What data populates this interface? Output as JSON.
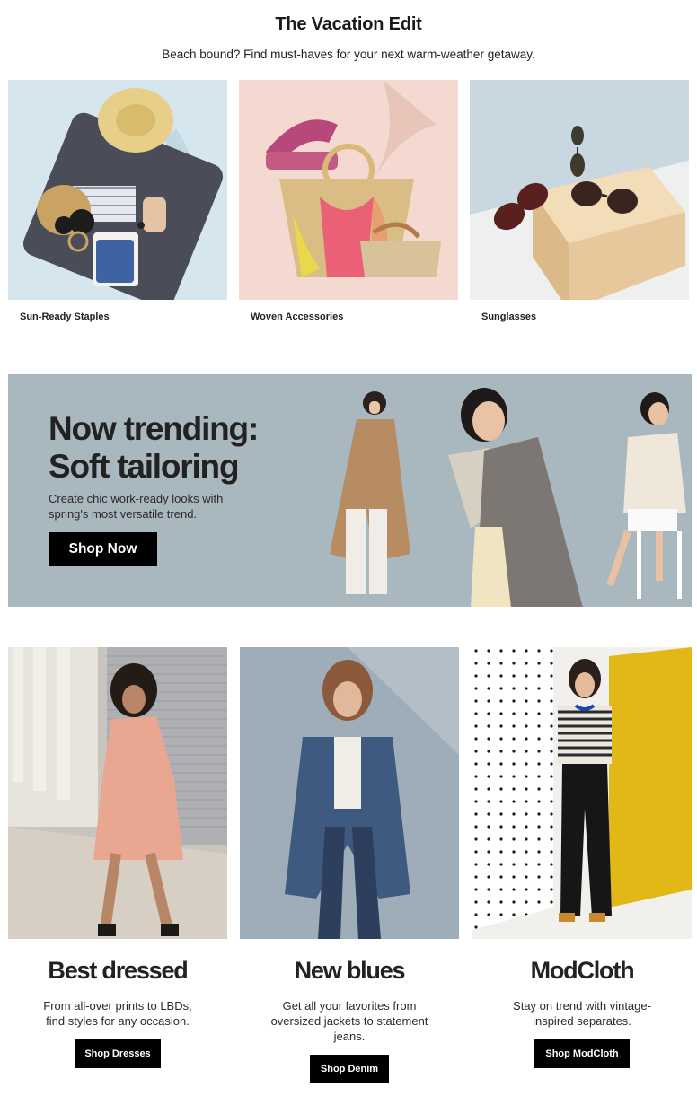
{
  "section": {
    "title": "The Vacation Edit",
    "subtitle": "Beach bound? Find must-haves for your next warm-weather getaway."
  },
  "tiles": [
    {
      "label": "Sun-Ready Staples"
    },
    {
      "label": "Woven Accessories"
    },
    {
      "label": "Sunglasses"
    }
  ],
  "banner": {
    "headline_line1": "Now trending:",
    "headline_line2": "Soft tailoring",
    "copy": "Create chic work-ready looks with spring's most versatile trend.",
    "cta": "Shop Now"
  },
  "cards": [
    {
      "title": "Best dressed",
      "description": "From all-over prints to LBDs, find styles for any occasion.",
      "cta": "Shop Dresses"
    },
    {
      "title": "New blues",
      "description": "Get all your favorites from oversized jackets to statement jeans.",
      "cta": "Shop Denim"
    },
    {
      "title": "ModCloth",
      "description": "Stay on trend with vintage-inspired separates.",
      "cta": "Shop ModCloth"
    }
  ],
  "colors": {
    "button_bg": "#000000",
    "banner_bg": "#a9b7bf",
    "tile1_bg": "#d6e6ef",
    "tile2_bg": "#f3d9cf",
    "tile3_bg": "#c9d8e0",
    "modcloth_yellow": "#e2b816"
  }
}
